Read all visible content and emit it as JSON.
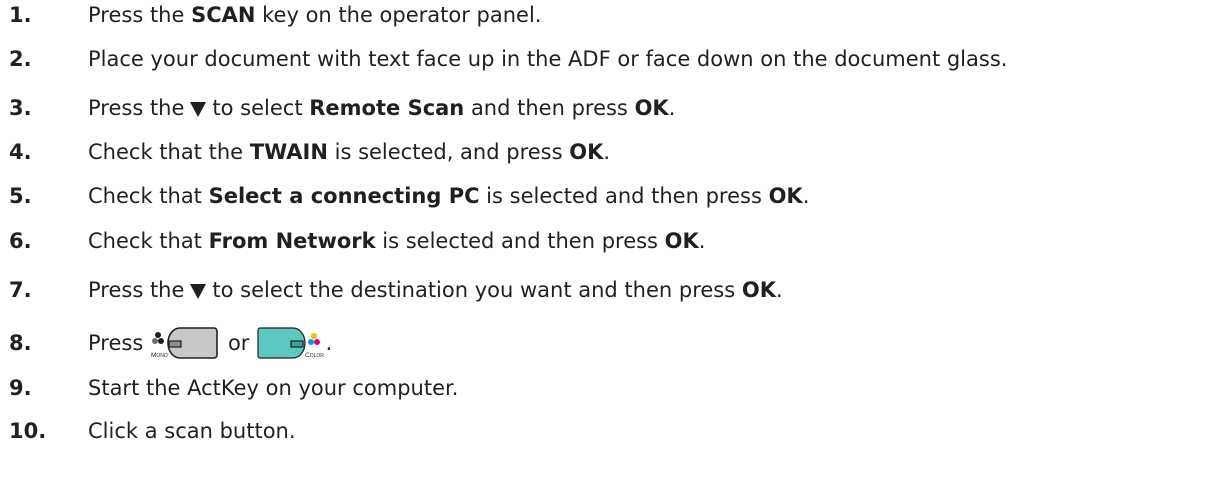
{
  "steps": [
    {
      "num": "1.",
      "parts": [
        "Press the ",
        "SCAN",
        " key on the operator panel."
      ]
    },
    {
      "num": "2.",
      "text": "Place your document with text face up in the ADF or face down on the document glass."
    },
    {
      "num": "3.",
      "parts": [
        "Press the",
        "to select ",
        "Remote Scan",
        " and then press ",
        "OK",
        "."
      ]
    },
    {
      "num": "4.",
      "parts": [
        "Check that the ",
        "TWAIN",
        " is selected, and press ",
        "OK",
        "."
      ]
    },
    {
      "num": "5.",
      "parts": [
        "Check that ",
        "Select a connecting PC",
        " is selected and then press ",
        "OK",
        "."
      ]
    },
    {
      "num": "6.",
      "parts": [
        "Check that ",
        "From Network",
        " is selected and then press ",
        "OK",
        "."
      ]
    },
    {
      "num": "7.",
      "parts": [
        "Press the",
        "to select the destination you want and then press ",
        "OK",
        "."
      ]
    },
    {
      "num": "8.",
      "parts": [
        "Press ",
        "or",
        "."
      ],
      "mono_label": "Mono",
      "color_label": "Color"
    },
    {
      "num": "9.",
      "text": "Start the ActKey on your computer."
    },
    {
      "num": "10.",
      "text": "Click a scan button."
    }
  ],
  "icons": {
    "down_arrow": "down-triangle-icon",
    "mono_button": "mono-button-icon",
    "color_button": "color-button-icon"
  },
  "colors": {
    "text": "#231f20",
    "mono_button": "#c8c8c8",
    "color_button": "#5cc8c0"
  }
}
